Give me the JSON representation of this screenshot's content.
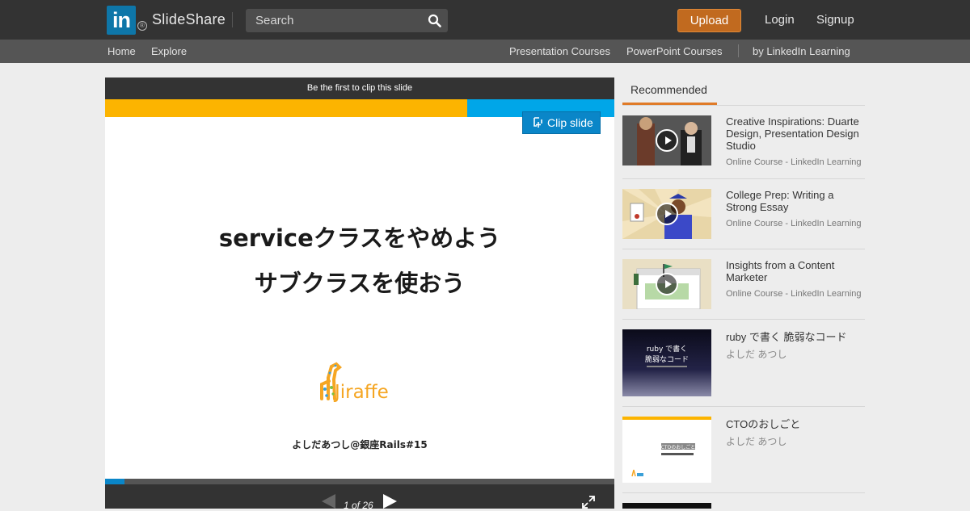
{
  "header": {
    "logo_text": "in",
    "logo_reg": "®",
    "brand": "SlideShare",
    "search_placeholder": "Search",
    "upload_label": "Upload",
    "login_label": "Login",
    "signup_label": "Signup"
  },
  "subnav": {
    "home": "Home",
    "explore": "Explore",
    "presentation_courses": "Presentation Courses",
    "powerpoint_courses": "PowerPoint Courses",
    "linkedin_learning": "by LinkedIn Learning"
  },
  "player": {
    "clip_banner": "Be the first to clip this slide",
    "clip_button": "Clip slide",
    "slide_title_1": "serviceクラスをやめよう",
    "slide_title_2": "サブクラスを使おう",
    "logo_word": "Jiraffe",
    "slide_footer": "よしだあつし@銀座Rails#15",
    "page_indicator": "1 of 26",
    "progress_fraction": 0.038
  },
  "recommended": {
    "tab_label": "Recommended",
    "items": [
      {
        "title": "Creative Inspirations: Duarte Design, Presentation Design Studio",
        "subtitle": "Online Course - LinkedIn Learning"
      },
      {
        "title": "College Prep: Writing a Strong Essay",
        "subtitle": "Online Course - LinkedIn Learning"
      },
      {
        "title": "Insights from a Content Marketer",
        "subtitle": "Online Course - LinkedIn Learning"
      },
      {
        "title": "ruby で書く 脆弱なコード",
        "subtitle": "よしだ あつし",
        "thumb_line1": "ruby で書く",
        "thumb_line2": "脆弱なコード"
      },
      {
        "title": "CTOのおしごと",
        "subtitle": "よしだ あつし",
        "thumb_label": "CTOのおしごと"
      }
    ]
  },
  "colors": {
    "topbar": "#333333",
    "subbar": "#555555",
    "upload": "#c16a1f",
    "accent_blue": "#0a86c8",
    "stripe_yellow": "#fcb400",
    "stripe_blue": "#00a6e8",
    "tab_underline": "#e07b28"
  }
}
